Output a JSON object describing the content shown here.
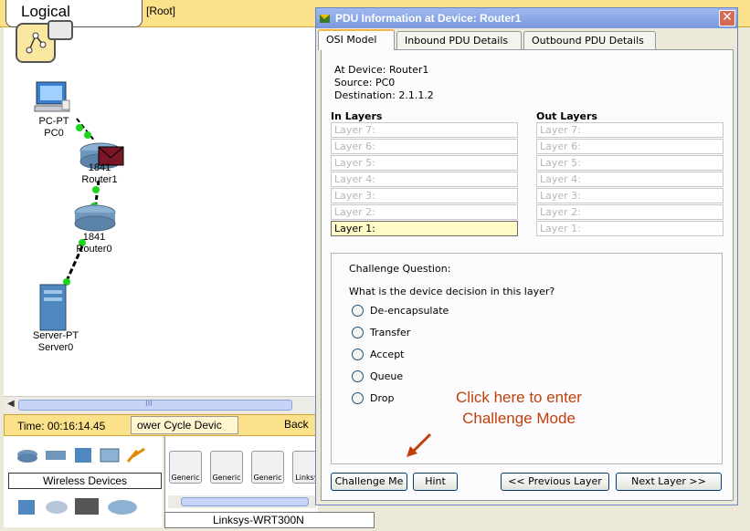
{
  "workspace": {
    "mode_tab": "Logical",
    "root_label": "[Root]",
    "devices": [
      {
        "type": "PC-PT",
        "name": "PC0"
      },
      {
        "type": "1841",
        "name": "Router1"
      },
      {
        "type": "1841",
        "name": "Router0"
      },
      {
        "type": "Server-PT",
        "name": "Server0"
      }
    ],
    "scroll_mark": "III"
  },
  "statusbar": {
    "time": "Time: 00:16:14.45",
    "power_cycle": "ower Cycle Devic",
    "back": "Back"
  },
  "device_panel": {
    "category_label": "Wireless Devices",
    "items": [
      "Generic",
      "Generic",
      "Generic",
      "Linksys"
    ],
    "selected_model": "Linksys-WRT300N"
  },
  "dialog": {
    "title": "PDU Information at Device: Router1",
    "tabs": [
      "OSI Model",
      "Inbound PDU Details",
      "Outbound PDU Details"
    ],
    "at_device": "At Device: Router1",
    "source": "Source: PC0",
    "destination": "Destination: 2.1.1.2",
    "in_layers_label": "In Layers",
    "out_layers_label": "Out Layers",
    "in_layers": [
      "Layer 7:",
      "Layer 6:",
      "Layer 5:",
      "Layer 4:",
      "Layer 3:",
      "Layer 2:",
      "Layer 1:"
    ],
    "out_layers": [
      "Layer 7:",
      "Layer 6:",
      "Layer 5:",
      "Layer 4:",
      "Layer 3:",
      "Layer 2:",
      "Layer 1:"
    ],
    "challenge": {
      "title": "Challenge Question:",
      "question": "What is the device decision in this layer?",
      "options": [
        "De-encapsulate",
        "Transfer",
        "Accept",
        "Queue",
        "Drop"
      ]
    },
    "annotation": [
      "Click here to enter",
      "Challenge Mode"
    ],
    "buttons": {
      "challenge": "Challenge Me",
      "hint": "Hint",
      "previous": "<< Previous Layer",
      "next": "Next Layer >>"
    },
    "close_glyph": "✕"
  },
  "colors": {
    "title_bar": "#7a99dd",
    "active_layer": "#fefbc6",
    "annotation": "#c0400c",
    "status_bar": "#fbe28a"
  }
}
